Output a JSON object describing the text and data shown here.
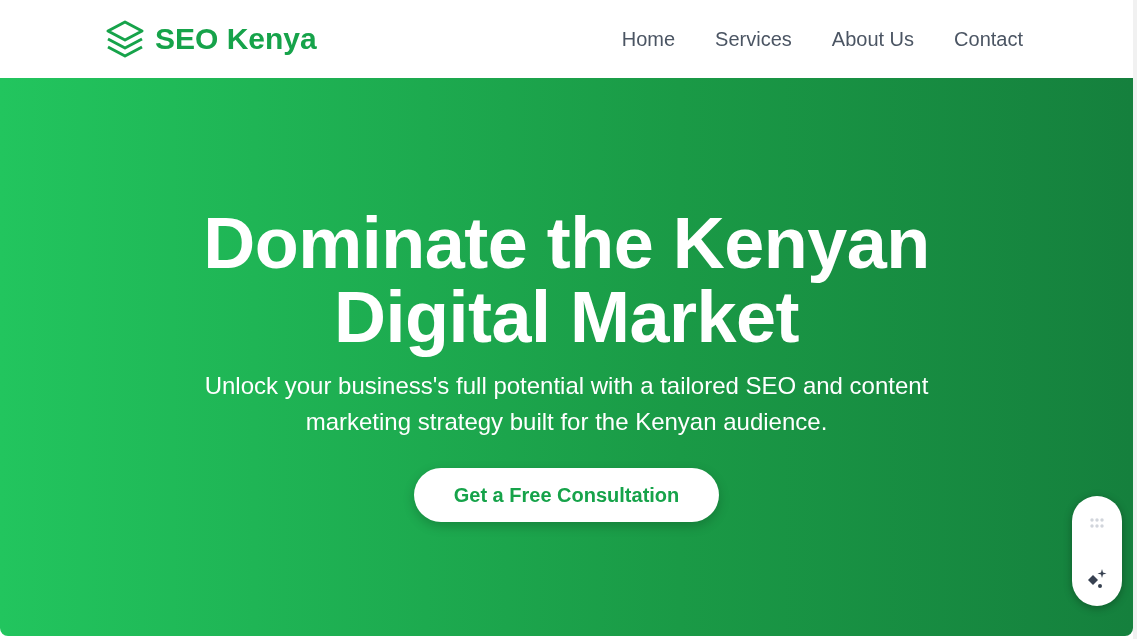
{
  "header": {
    "brand": "SEO Kenya",
    "nav": [
      {
        "label": "Home"
      },
      {
        "label": "Services"
      },
      {
        "label": "About Us"
      },
      {
        "label": "Contact"
      }
    ]
  },
  "hero": {
    "title_lines": [
      "Dominate the Kenyan",
      "Digital Market"
    ],
    "subtitle_lines": [
      "Unlock your business's full potential with a tailored SEO and content",
      "marketing strategy built for the Kenyan audience."
    ],
    "cta": "Get a Free Consultation"
  }
}
